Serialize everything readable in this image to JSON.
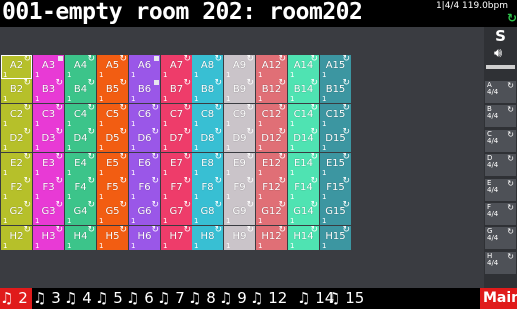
{
  "header": {
    "title": "001-empty room 202: room202",
    "status": "1|4/4 119.0bpm",
    "record_icon": "loop-icon"
  },
  "colors": {
    "A": "#b6c02a",
    "3": "#e83ad5",
    "4": "#3cc48a",
    "5": "#f25d12",
    "6": "#9a57e8",
    "7": "#ee3c6a",
    "8": "#38bfd3",
    "9": "#cac4c9",
    "12": "#e06f76",
    "14": "#4fe3b2",
    "15": "#3c96a1"
  },
  "grid": {
    "rows": [
      [
        "A2",
        "A3",
        "A4",
        "A5",
        "A6",
        "A7",
        "A8",
        "A9",
        "A12",
        "A14",
        "A15"
      ],
      [
        "B2",
        "B3",
        "B4",
        "B5",
        "B6",
        "B7",
        "B8",
        "B9",
        "B12",
        "B14",
        "B15"
      ],
      [
        "C2",
        "C3",
        "C4",
        "C5",
        "C6",
        "C7",
        "C8",
        "C9",
        "C12",
        "C14",
        "C15"
      ],
      [
        "D2",
        "D3",
        "D4",
        "D5",
        "D6",
        "D7",
        "D8",
        "D9",
        "D12",
        "D14",
        "D15"
      ],
      [
        "E2",
        "E3",
        "E4",
        "E5",
        "E6",
        "E7",
        "E8",
        "E9",
        "E12",
        "E14",
        "E15"
      ],
      [
        "F2",
        "F3",
        "F4",
        "F5",
        "F6",
        "F7",
        "F8",
        "F9",
        "F12",
        "F14",
        "F15"
      ],
      [
        "G2",
        "G3",
        "G4",
        "G5",
        "G6",
        "G7",
        "G8",
        "G9",
        "G12",
        "G14",
        "G15"
      ],
      [
        "H2",
        "H3",
        "H4",
        "H5",
        "H6",
        "H7",
        "H8",
        "H9",
        "H12",
        "H14",
        "H15"
      ]
    ],
    "slot_number": "1",
    "flags": [
      "A3",
      "A6",
      "B6"
    ]
  },
  "scenes": {
    "header_label": "S",
    "items": [
      {
        "name": "A",
        "sig": "4/4"
      },
      {
        "name": "B",
        "sig": "4/4"
      },
      {
        "name": "C",
        "sig": "4/4"
      },
      {
        "name": "D",
        "sig": "4/4"
      },
      {
        "name": "E",
        "sig": "4/4"
      },
      {
        "name": "F",
        "sig": "4/4"
      },
      {
        "name": "G",
        "sig": "4/4"
      },
      {
        "name": "H",
        "sig": "4/4"
      }
    ]
  },
  "tracks": {
    "tabs": [
      {
        "label": "♫ 2",
        "active": true
      },
      {
        "label": "♫ 3"
      },
      {
        "label": "♫ 4"
      },
      {
        "label": "♫ 5"
      },
      {
        "label": "♫ 6"
      },
      {
        "label": "♫ 7"
      },
      {
        "label": "♫ 8"
      },
      {
        "label": "♫ 9"
      },
      {
        "label": "♫ 12"
      },
      {
        "label": "♫ 14"
      },
      {
        "label": "♫ 15"
      }
    ],
    "main_label": "Main"
  }
}
